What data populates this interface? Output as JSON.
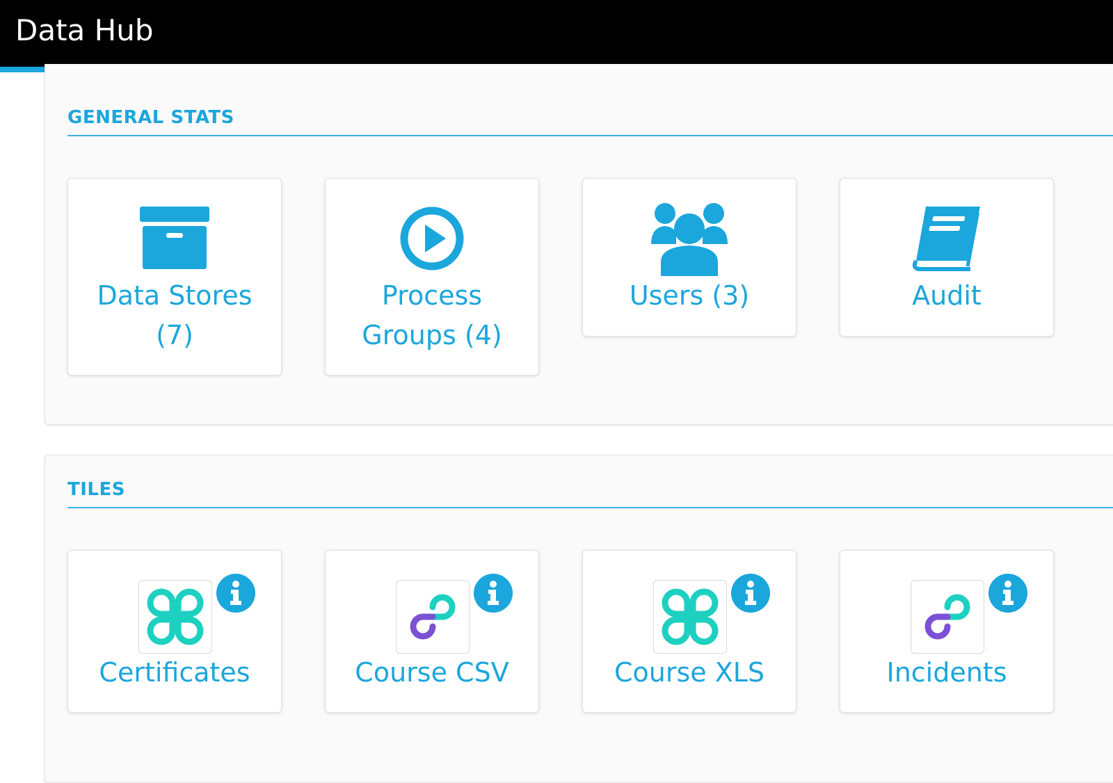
{
  "app": {
    "title": "Data Hub",
    "progress_fraction": 0.155
  },
  "colors": {
    "accent": "#1ba6dc",
    "tile_teal": "#1dd0c0",
    "tile_purple": "#7b52d4",
    "topbar": "#000000"
  },
  "general_stats": {
    "heading": "GENERAL STATS",
    "cards": [
      {
        "line1": "Data Stores",
        "line2": "(7)",
        "icon": "archive-box-icon"
      },
      {
        "line1": "Process",
        "line2": "Groups (4)",
        "icon": "play-circle-icon"
      },
      {
        "line1": "Users (3)",
        "line2": "",
        "icon": "users-icon"
      },
      {
        "line1": "Audit",
        "line2": "",
        "icon": "book-icon"
      }
    ]
  },
  "tiles": {
    "heading": "TILES",
    "items": [
      {
        "label": "Certificates",
        "logo": "clover-logo-icon"
      },
      {
        "label": "Course CSV",
        "logo": "chain-link-logo-icon"
      },
      {
        "label": "Course XLS",
        "logo": "clover-logo-icon"
      },
      {
        "label": "Incidents",
        "logo": "chain-link-logo-icon"
      }
    ]
  }
}
